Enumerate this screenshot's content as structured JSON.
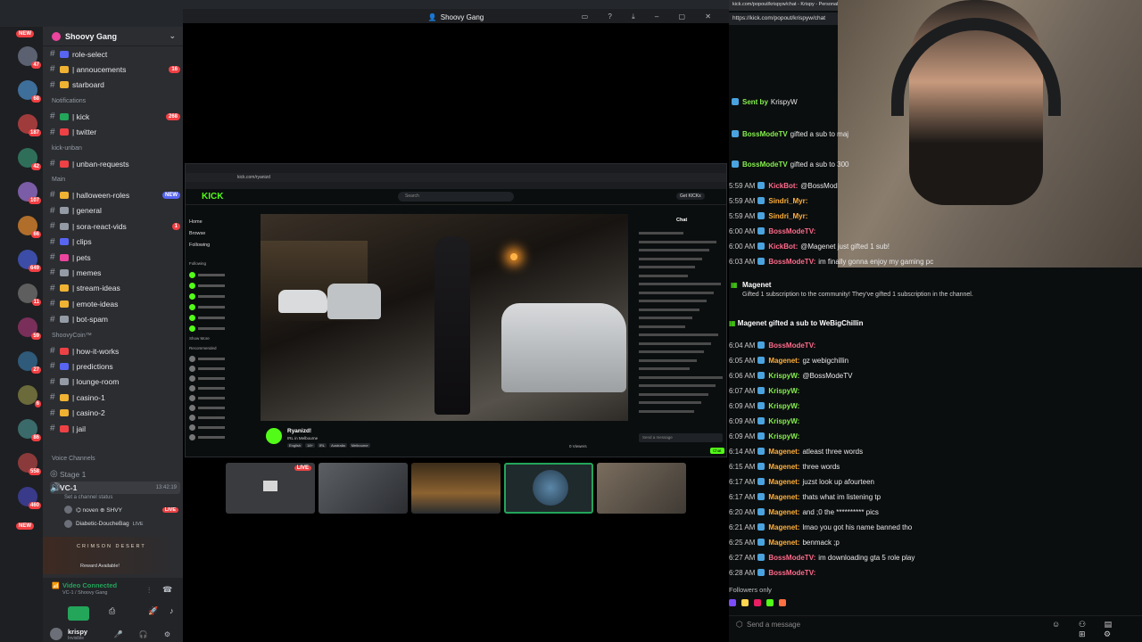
{
  "discord": {
    "guild_name": "Shoovy Gang",
    "window_title": "Shoovy Gang",
    "rail_new": "NEW",
    "rail_new2": "NEW",
    "rail_badges": [
      "47",
      "68",
      "187",
      "42",
      "107",
      "66",
      "649",
      "11",
      "59",
      "27",
      "6",
      "86",
      "558",
      "460"
    ],
    "channels": [
      {
        "label": "role-select",
        "color": "#5865f2",
        "count": ""
      },
      {
        "label": "| annoucements",
        "color": "#f0b232",
        "count": "16"
      },
      {
        "label": "starboard",
        "color": "#f0b232",
        "count": ""
      }
    ],
    "notif_category": "Notifications",
    "notif_channels": [
      {
        "label": "| kick",
        "color": "#23a55a",
        "count": "268"
      },
      {
        "label": "| twitter",
        "color": "#ed4245",
        "count": ""
      }
    ],
    "kick_category": "kick-unban",
    "kick_channels": [
      {
        "label": "| unban-requests",
        "color": "#ed4245",
        "count": ""
      }
    ],
    "main_category": "Main",
    "main_channels": [
      {
        "label": "| halloween-roles",
        "color": "#f0b232",
        "count": "NEW"
      },
      {
        "label": "| general",
        "color": "#949ba4",
        "count": ""
      },
      {
        "label": "| sora-react-vids",
        "color": "#949ba4",
        "count": "1"
      },
      {
        "label": "| clips",
        "color": "#5865f2",
        "count": ""
      },
      {
        "label": "| pets",
        "color": "#eb459e",
        "count": ""
      },
      {
        "label": "| memes",
        "color": "#949ba4",
        "count": ""
      },
      {
        "label": "| stream-ideas",
        "color": "#f0b232",
        "count": ""
      },
      {
        "label": "| emote-ideas",
        "color": "#f0b232",
        "count": ""
      },
      {
        "label": "| bot-spam",
        "color": "#949ba4",
        "count": ""
      }
    ],
    "coins_category": "ShoovyCoin™",
    "coins_channels": [
      {
        "label": "| how-it-works",
        "color": "#ed4245",
        "count": ""
      },
      {
        "label": "| predictions",
        "color": "#5865f2",
        "count": ""
      },
      {
        "label": "| lounge-room",
        "color": "#949ba4",
        "count": ""
      },
      {
        "label": "| casino-1",
        "color": "#f0b232",
        "count": ""
      },
      {
        "label": "| casino-2",
        "color": "#f0b232",
        "count": ""
      },
      {
        "label": "| jail",
        "color": "#ed4245",
        "count": ""
      }
    ],
    "voice_category": "Voice Channels",
    "stage_label": "Stage 1",
    "vc_label": "VC-1",
    "vc_time": "13:42:19",
    "vc_status": "Set a channel status",
    "vc_users": [
      {
        "name": "⌬ noven ⊕ SHVY",
        "live": "LIVE"
      },
      {
        "name": "Diabetic-DoucheBag",
        "live": "LIVE"
      }
    ],
    "promo_title": "CRIMSON DESERT",
    "promo_sub": "Reward Available!",
    "vc_connected": "Video Connected",
    "vc_connected_sub": "VC-1 / Shoovy Gang",
    "user_name": "krispy",
    "user_status": "Invisible"
  },
  "kick": {
    "url": "kick.com/ryanizd",
    "search_placeholder": "Search",
    "nav": [
      "Home",
      "Browse",
      "Following"
    ],
    "following_label": "Following",
    "recommended_label": "Recommended",
    "show_more": "Show More",
    "chat_title": "Chat",
    "streamer_name": "Ryanizd!",
    "stream_sub": "IRL in Melbourne",
    "tags": [
      "English",
      "18+",
      "IRL",
      "Australia",
      "Melbourne"
    ],
    "viewers": "0 Viewers",
    "chat_placeholder": "Send a message",
    "chat_button": "Chat",
    "get_kicks": "Get KICKs",
    "live_badge": "LIVE"
  },
  "popout": {
    "url": "https://kick.com/popout/krispyw/chat",
    "window_title": "kick.com/popout/krispyw/chat - Krispy - Personal - M",
    "chat_placeholder": "Send a message",
    "followers_only": "Followers only",
    "messages": [
      {
        "time": "",
        "user": "Sent by",
        "text": "KrispyW",
        "cls": "lime"
      },
      {
        "time": "",
        "user": "BossModeTV",
        "text": "gifted a sub to maj",
        "cls": "lime"
      },
      {
        "time": "",
        "user": "BossModeTV",
        "text": "gifted a sub to 300",
        "cls": "lime"
      },
      {
        "time": "5:59 AM",
        "user": "KickBot:",
        "text": "@BossMod",
        "cls": "pink"
      },
      {
        "time": "5:59 AM",
        "user": "Sindri_Myr:",
        "text": "",
        "cls": "orange"
      },
      {
        "time": "5:59 AM",
        "user": "Sindri_Myr:",
        "text": "",
        "cls": "orange"
      },
      {
        "time": "6:00 AM",
        "user": "BossModeTV:",
        "text": "",
        "cls": "pink"
      },
      {
        "time": "6:00 AM",
        "user": "KickBot:",
        "text": "@Magenet just gifted 1 sub!",
        "cls": "pink"
      },
      {
        "time": "6:03 AM",
        "user": "BossModeTV:",
        "text": "im finally gonna enjoy my gaming pc",
        "cls": "pink"
      }
    ],
    "gift_title": "Magenet",
    "gift_text": "Gifted 1 subscription to the community! They've gifted 1 subscription in the channel.",
    "gift_line": "Magenet gifted a sub to WeBigChillin",
    "messages2": [
      {
        "time": "6:04 AM",
        "user": "BossModeTV:",
        "text": "",
        "cls": "pink"
      },
      {
        "time": "6:05 AM",
        "user": "Magenet:",
        "text": "gz webigchillin",
        "cls": "orange"
      },
      {
        "time": "6:06 AM",
        "user": "KrispyW:",
        "text": "@BossModeTV",
        "cls": "lime"
      },
      {
        "time": "6:07 AM",
        "user": "KrispyW:",
        "text": "",
        "cls": "lime"
      },
      {
        "time": "6:09 AM",
        "user": "KrispyW:",
        "text": "",
        "cls": "lime"
      },
      {
        "time": "6:09 AM",
        "user": "KrispyW:",
        "text": "",
        "cls": "lime"
      },
      {
        "time": "6:09 AM",
        "user": "KrispyW:",
        "text": "",
        "cls": "lime"
      },
      {
        "time": "6:14 AM",
        "user": "Magenet:",
        "text": "atleast three words",
        "cls": "orange"
      },
      {
        "time": "6:15 AM",
        "user": "Magenet:",
        "text": "three words",
        "cls": "orange"
      },
      {
        "time": "6:17 AM",
        "user": "Magenet:",
        "text": "juzst look up afourteen",
        "cls": "orange"
      },
      {
        "time": "6:17 AM",
        "user": "Magenet:",
        "text": "thats what im listening tp",
        "cls": "orange"
      },
      {
        "time": "6:20 AM",
        "user": "Magenet:",
        "text": "and ;0 the ********** pics",
        "cls": "orange"
      },
      {
        "time": "6:21 AM",
        "user": "Magenet:",
        "text": "lmao you got his name banned tho",
        "cls": "orange"
      },
      {
        "time": "6:25 AM",
        "user": "Magenet:",
        "text": "benmack ;p",
        "cls": "orange"
      },
      {
        "time": "6:27 AM",
        "user": "BossModeTV:",
        "text": "im downloading gta 5 role play",
        "cls": "pink"
      },
      {
        "time": "6:28 AM",
        "user": "BossModeTV:",
        "text": "",
        "cls": "pink"
      }
    ]
  },
  "live_label": "LIVE"
}
